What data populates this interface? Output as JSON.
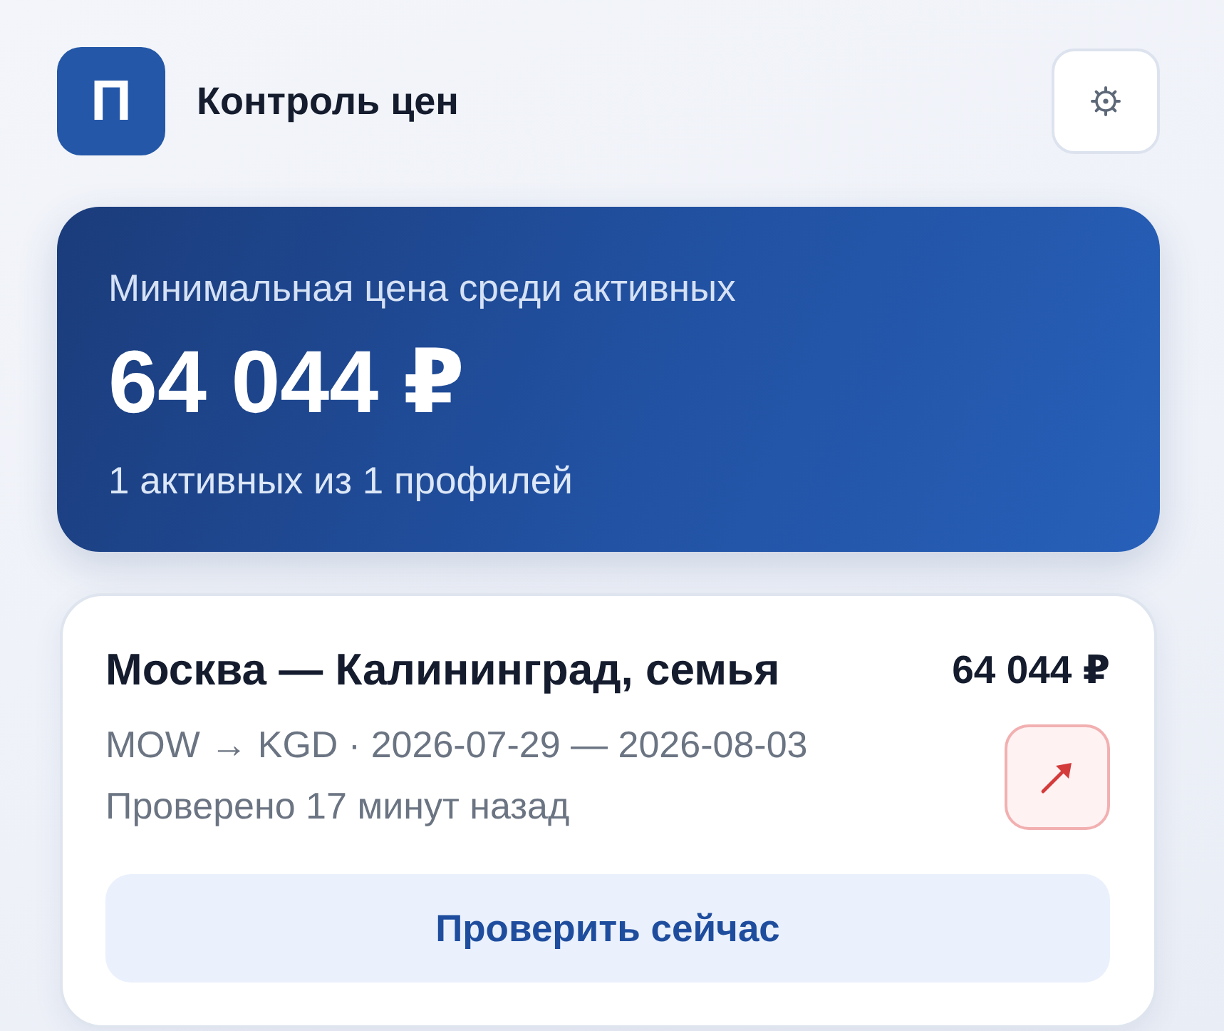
{
  "header": {
    "logo_letter": "П",
    "title": "Контроль цен"
  },
  "summary": {
    "label": "Минимальная цена среди активных",
    "price": "64 044 ₽",
    "subtitle": "1 активных из 1 профилей"
  },
  "profiles": [
    {
      "title": "Москва — Калининград, семья",
      "price": "64 044 ₽",
      "route": "MOW → KGD · 2026-07-29 — 2026-08-03",
      "checked": "Проверено 17 минут назад",
      "price_rising": true,
      "check_button": "Проверить сейчас"
    }
  ]
}
